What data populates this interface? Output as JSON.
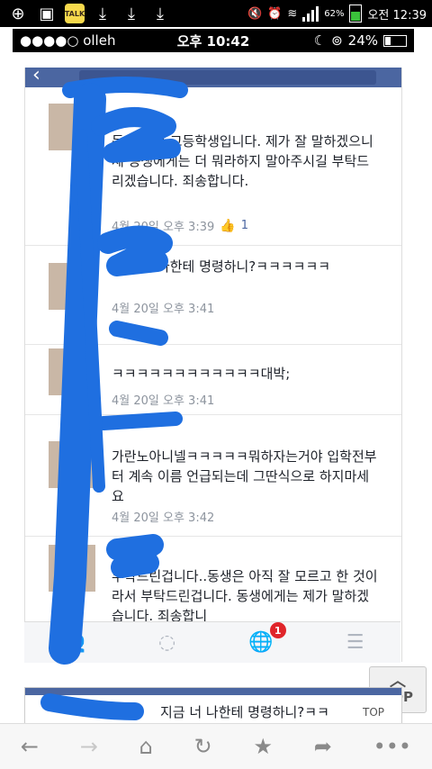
{
  "android_status": {
    "icons": [
      "plus-icon",
      "image-icon",
      "kakaotalk-icon",
      "download-icon",
      "download-icon",
      "download-icon"
    ],
    "talk_label": "TALK",
    "battery_percent": "62%",
    "time": "오전 12:39"
  },
  "ios_status": {
    "carrier": "●●●●○ olleh",
    "time": "오후 10:42",
    "battery": "24%"
  },
  "comments": [
    {
      "text": "동생 아직 고등학생입니다. 제가 잘 말하겠으니 제 동생에게는 더 뭐라하지 말아주시길 부탁드리겠습니다. 죄송합니다.",
      "time": "4월 20일 오후 3:39",
      "likes": "1"
    },
    {
      "text": "지금 너 나한테 명령하니?ㅋㅋㅋㅋㅋㅋ",
      "time": "4월 20일 오후 3:41"
    },
    {
      "text": "ㅋㅋㅋㅋㅋㅋㅋㅋㅋㅋㅋㅋ대박;",
      "time": "4월 20일 오후 3:41"
    },
    {
      "text": "가란노아니넬ㅋㅋㅋㅋㅋ뭐하자는거야 입학전부터 계속 이름 언급되는데 그딴식으로 하지마세요",
      "time": "4월 20일 오후 3:42"
    },
    {
      "text": "부탁드린겁니다..동생은 아직 잘 모르고 한 것이라서 부탁드린겁니다. 동생에게는 제가 말하겠습니다. 죄송합니"
    }
  ],
  "tabbar": {
    "notification_count": "1"
  },
  "top_button": {
    "label": "TOP"
  },
  "peek": {
    "text": "지금 너 나한테 명령하니?ㅋㅋ",
    "top_label": "TOP"
  },
  "colors": {
    "facebook_blue": "#4b66a1",
    "scribble_blue": "#1f6fe0",
    "badge_red": "#e0252a"
  }
}
